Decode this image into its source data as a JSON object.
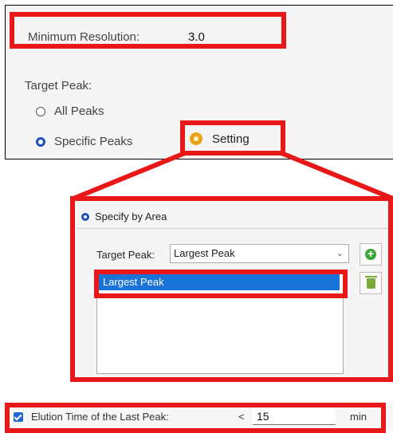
{
  "resolution": {
    "label": "Minimum Resolution:",
    "value": "3.0"
  },
  "target_peak": {
    "label": "Target Peak:",
    "options": [
      {
        "label": "All Peaks",
        "selected": false
      },
      {
        "label": "Specific Peaks",
        "selected": true
      }
    ],
    "setting_button": "Setting"
  },
  "specify_area": {
    "radio_label": "Specify by Area",
    "selected": true,
    "target_label": "Target Peak:",
    "select_value": "Largest Peak",
    "list_items": [
      "Largest Peak"
    ],
    "add_icon": "add-circle-icon",
    "delete_icon": "trash-icon"
  },
  "elution": {
    "checked": true,
    "label": "Elution Time of the Last Peak:",
    "operator": "<",
    "value": "15",
    "unit": "min"
  },
  "colors": {
    "highlight": "#e81818",
    "accent": "#1c52b6",
    "selection": "#1a73d9",
    "add_green": "#3aa538"
  }
}
